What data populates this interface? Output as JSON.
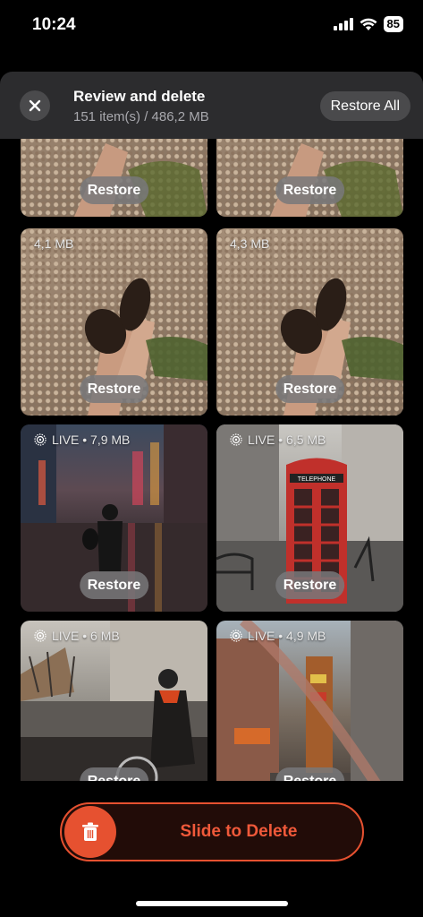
{
  "status": {
    "time": "10:24",
    "battery": "85"
  },
  "header": {
    "title": "Review and delete",
    "subtitle": "151 item(s) / 486,2 MB",
    "restore_all_label": "Restore All"
  },
  "tiles": [
    {
      "label": "",
      "restore_label": "Restore"
    },
    {
      "label": "",
      "restore_label": "Restore"
    },
    {
      "label": "4,1 MB",
      "restore_label": "Restore"
    },
    {
      "label": "4,3 MB",
      "restore_label": "Restore"
    },
    {
      "label": "LIVE • 7,9 MB",
      "restore_label": "Restore"
    },
    {
      "label": "LIVE • 6,5 MB",
      "restore_label": "Restore"
    },
    {
      "label": "LIVE • 6 MB",
      "restore_label": "Restore"
    },
    {
      "label": "LIVE • 4,9 MB",
      "restore_label": "Restore"
    }
  ],
  "phone_sign": "TELEPHONE",
  "slider": {
    "label": "Slide to Delete"
  },
  "colors": {
    "accent": "#e65130",
    "header_bg": "#2c2c2e",
    "button_bg": "#4a4a4c"
  }
}
